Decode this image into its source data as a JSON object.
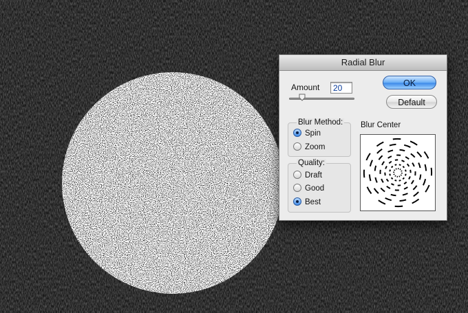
{
  "dialog": {
    "title": "Radial Blur",
    "amount": {
      "label": "Amount",
      "value": "20",
      "slider_fraction": 0.2
    },
    "buttons": {
      "ok": "OK",
      "default": "Default"
    },
    "blur_method": {
      "title": "Blur Method:",
      "options": [
        "Spin",
        "Zoom"
      ],
      "selected": "Spin"
    },
    "quality": {
      "title": "Quality:",
      "options": [
        "Draft",
        "Good",
        "Best"
      ],
      "selected": "Best"
    },
    "blur_center": {
      "label": "Blur Center"
    }
  },
  "colors": {
    "accent": "#3d8ae9",
    "canvas_bg": "#1c1c1c",
    "dialog_bg": "#ececec"
  }
}
